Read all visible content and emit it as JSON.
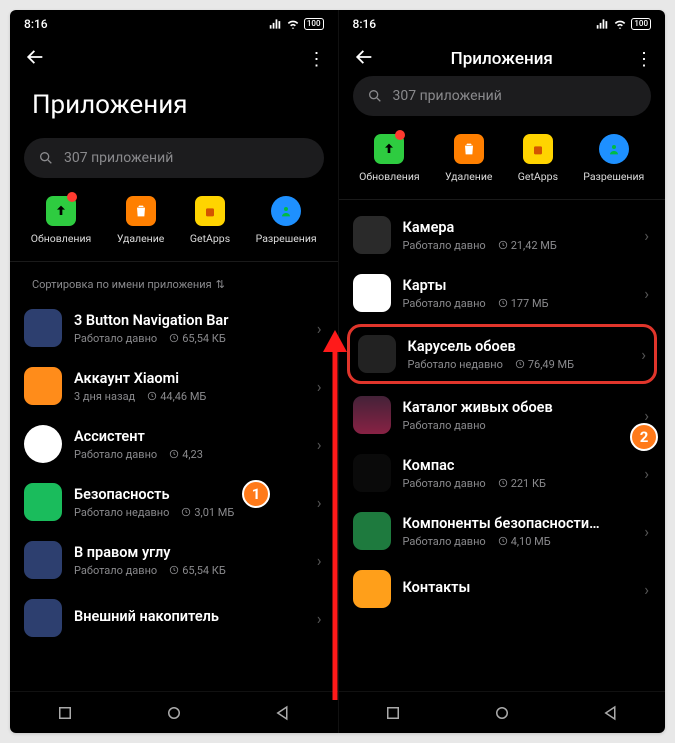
{
  "status": {
    "time": "8:16",
    "battery": "100"
  },
  "header": {
    "title": "Приложения"
  },
  "search": {
    "placeholder": "307 приложений"
  },
  "quick": [
    {
      "label": "Обновления",
      "style": "green",
      "icon": "arrow-up",
      "badge": true
    },
    {
      "label": "Удаление",
      "style": "orange",
      "icon": "trash"
    },
    {
      "label": "GetApps",
      "style": "yellow",
      "icon": "bag"
    },
    {
      "label": "Разрешения",
      "style": "blue",
      "icon": "person"
    }
  ],
  "sort_label": "Сортировка по имени приложения",
  "left_apps": [
    {
      "name": "3 Button Navigation Bar",
      "status": "Работало давно",
      "size": "65,54 КБ",
      "icon": "ai-android"
    },
    {
      "name": "Аккаунт Xiaomi",
      "status": "3 дня назад",
      "size": "44,46 МБ",
      "icon": "ai-mi"
    },
    {
      "name": "Ассистент",
      "status": "Работало давно",
      "size": "4,23",
      "icon": "ai-assist"
    },
    {
      "name": "Безопасность",
      "status": "Работало недавно",
      "size": "3,01 МБ",
      "icon": "ai-sec"
    },
    {
      "name": "В правом углу",
      "status": "Работало давно",
      "size": "65,54 КБ",
      "icon": "ai-corner"
    },
    {
      "name": "Внешний накопитель",
      "status": "",
      "size": "",
      "icon": "ai-ext"
    }
  ],
  "right_apps": [
    {
      "name": "Камера",
      "status": "Работало давно",
      "size": "21,42 МБ",
      "icon": "ai-cam"
    },
    {
      "name": "Карты",
      "status": "Работало давно",
      "size": "177 МБ",
      "icon": "ai-maps"
    },
    {
      "name": "Карусель обоев",
      "status": "Работало недавно",
      "size": "76,49 МБ",
      "icon": "ai-carousel",
      "hl": true
    },
    {
      "name": "Каталог живых обоев",
      "status": "Работало давно",
      "size": "",
      "icon": "ai-catalog"
    },
    {
      "name": "Компас",
      "status": "Работало давно",
      "size": "221 КБ",
      "icon": "ai-compass"
    },
    {
      "name": "Компоненты безопасности…",
      "status": "Работало давно",
      "size": "4,10 МБ",
      "icon": "ai-comp"
    },
    {
      "name": "Контакты",
      "status": "",
      "size": "",
      "icon": "ai-contacts"
    }
  ],
  "markers": {
    "one": "1",
    "two": "2"
  }
}
